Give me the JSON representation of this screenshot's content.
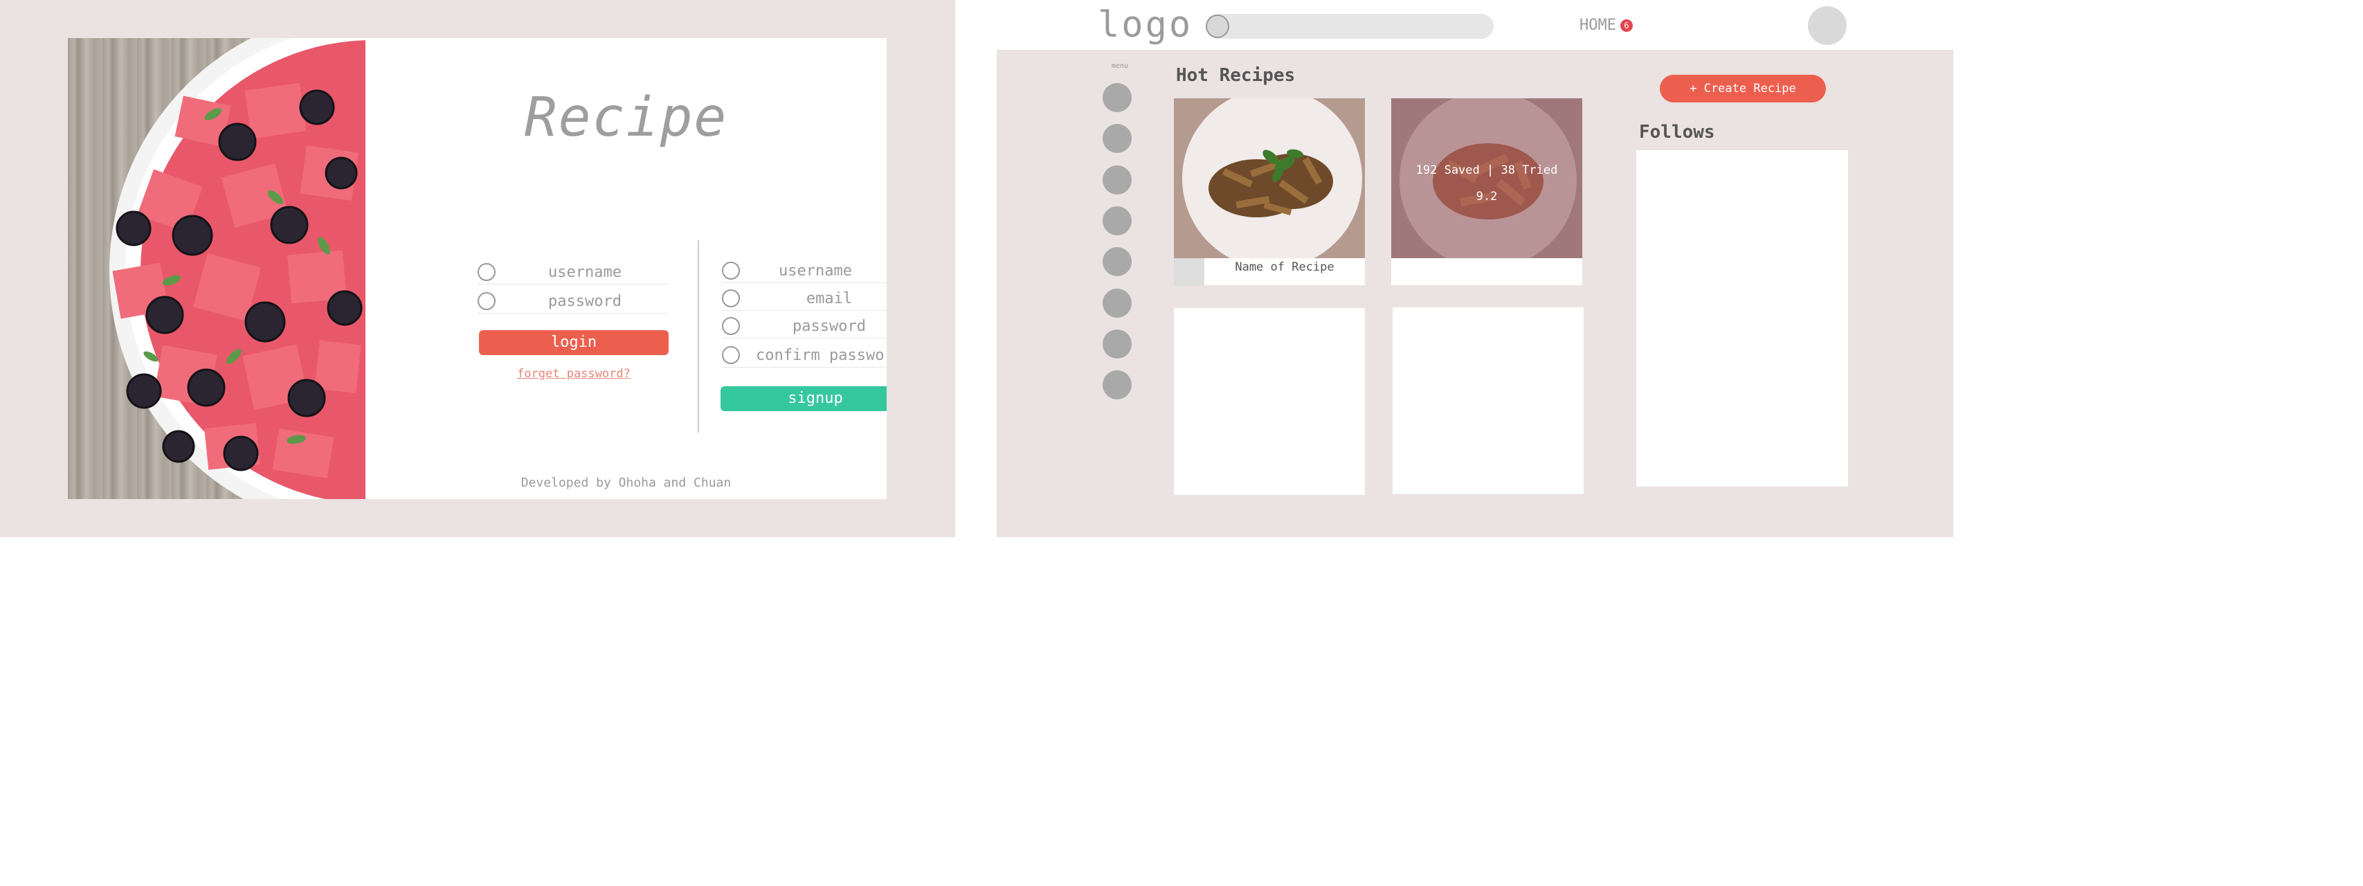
{
  "login_screen": {
    "title": "Recipe",
    "login": {
      "username_placeholder": "username",
      "password_placeholder": "password",
      "login_label": "login",
      "forgot_label": "forget password?"
    },
    "signup": {
      "username_placeholder": "username",
      "email_placeholder": "email",
      "password_placeholder": "password",
      "confirm_placeholder": "confirm password",
      "signup_label": "signup"
    },
    "credit": "Developed by Ohoha and Chuan",
    "colors": {
      "login": "#ec5f4e",
      "signup": "#35c79d",
      "background": "#ebe2e2"
    },
    "icons": [
      "radio-icon",
      "check-icon"
    ]
  },
  "home_screen": {
    "logo": "logo",
    "nav": {
      "home_label": "HOME",
      "notification_count": "6"
    },
    "sidebar": {
      "menu_label": "menu",
      "item_count": 8
    },
    "section_title": "Hot Recipes",
    "recipes": [
      {
        "name": "Name of Recipe"
      },
      {
        "stats": "192 Saved | 38 Tried",
        "rating": "9.2"
      },
      {},
      {}
    ],
    "create_label": "+ Create Recipe",
    "follows_title": "Follows",
    "colors": {
      "accent": "#ec5f4e",
      "badge": "#e4454f",
      "background": "#ebe2e2"
    }
  }
}
